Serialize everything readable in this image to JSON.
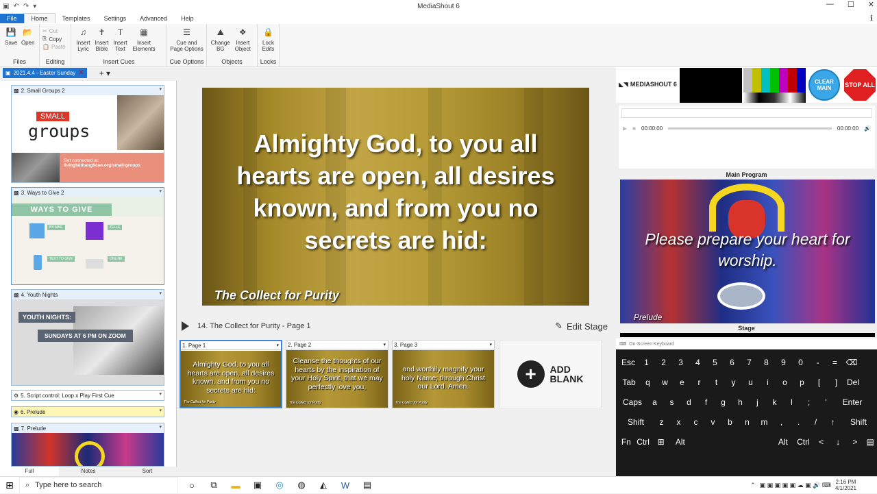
{
  "app": {
    "title": "MediaShout 6"
  },
  "menu": {
    "tabs": [
      "File",
      "Home",
      "Templates",
      "Settings",
      "Advanced",
      "Help"
    ],
    "active": "Home"
  },
  "ribbon": {
    "files": {
      "label": "Files",
      "save": "Save",
      "open": "Open"
    },
    "editing": {
      "label": "Editing",
      "cut": "Cut",
      "copy": "Copy",
      "paste": "Paste"
    },
    "insert_cues": {
      "label": "Insert Cues",
      "lyric": "Insert Lyric",
      "bible": "Insert Bible",
      "text": "Insert Text",
      "elements": "Insert Elements"
    },
    "cue_options": {
      "label": "Cue Options",
      "cue_page": "Cue and Page Options"
    },
    "objects": {
      "label": "Objects",
      "bg": "Change BG",
      "object": "Insert Object"
    },
    "locks": {
      "label": "Locks",
      "lock": "Lock Edits"
    }
  },
  "doc_tab": {
    "label": "2021.4.4 - Easter Sunday"
  },
  "cues": [
    {
      "title": "2. Small Groups 2",
      "thumb": {
        "badge": "SMALL",
        "word": "groups",
        "cta": "Get connected at:",
        "url": "livingfaithanglican.org/small-groups"
      }
    },
    {
      "title": "3. Ways to Give 2",
      "thumb": {
        "header": "WAYS TO GIVE",
        "mail": "BY MAIL",
        "zelle": "ZELLE",
        "text": "TEXT TO GIVE",
        "online": "ONLINE"
      }
    },
    {
      "title": "4. Youth Nights",
      "thumb": {
        "line1": "YOUTH NIGHTS:",
        "line2": "SUNDAYS AT 6 PM ON ZOOM"
      }
    },
    {
      "title": "5. Script control: Loop x Play First Cue"
    },
    {
      "title": "6. Prelude"
    },
    {
      "title": "7. Prelude"
    }
  ],
  "left_bottom_tabs": [
    "Full",
    "Notes",
    "Sort"
  ],
  "preview": {
    "text": "Almighty God, to you all hearts are open, all desires known, and from you no secrets are hid:",
    "footer": "The Collect for Purity"
  },
  "cue_bar": {
    "title": "14. The Collect for Purity",
    "sep": "-",
    "page": "Page 1",
    "edit_stage": "Edit Stage"
  },
  "pages": [
    {
      "label": "1. Page 1",
      "text": "Almighty God, to you all hearts are open, all desires known, and from you no secrets are hid:",
      "foot": "The Collect for Purity"
    },
    {
      "label": "2. Page 2",
      "text": "Cleanse the thoughts of our hearts by the inspiration of your Holy Spirit, that we may perfectly love you,",
      "foot": "The Collect for Purity"
    },
    {
      "label": "3. Page 3",
      "text": "and worthily magnify your holy Name; through Christ our Lord. Amen.",
      "foot": "The Collect for Purity"
    }
  ],
  "add_blank": {
    "line1": "ADD",
    "line2": "BLANK"
  },
  "right": {
    "logo": "MEDIASHOUT 6",
    "clear_main": "CLEAR MAIN",
    "stop_all": "STOP ALL",
    "time_start": "00:00:00",
    "time_end": "00:00:00",
    "main_label": "Main Program",
    "main_text": "Please prepare your heart for worship.",
    "main_footer": "Prelude",
    "stage_label": "Stage"
  },
  "osk": {
    "title": "On-Screen Keyboard",
    "rows": [
      [
        "Esc",
        "1",
        "2",
        "3",
        "4",
        "5",
        "6",
        "7",
        "8",
        "9",
        "0",
        "-",
        "=",
        "⌫"
      ],
      [
        "Tab",
        "q",
        "w",
        "e",
        "r",
        "t",
        "y",
        "u",
        "i",
        "o",
        "p",
        "[",
        "]",
        "Del"
      ],
      [
        "Caps",
        "a",
        "s",
        "d",
        "f",
        "g",
        "h",
        "j",
        "k",
        "l",
        ";",
        "'",
        "Enter"
      ],
      [
        "Shift",
        "z",
        "x",
        "c",
        "v",
        "b",
        "n",
        "m",
        ",",
        ".",
        "/",
        "↑",
        "Shift"
      ],
      [
        "Fn",
        "Ctrl",
        "⊞",
        "Alt",
        "",
        "Alt",
        "Ctrl",
        "<",
        "↓",
        ">",
        "▤"
      ]
    ]
  },
  "taskbar": {
    "search": "Type here to search",
    "time": "2:16 PM",
    "date": "4/1/2021"
  },
  "colors": {
    "accent": "#1e73d1",
    "gold": "#b59a37",
    "stop": "#e02020",
    "clear": "#3aa7e8"
  }
}
